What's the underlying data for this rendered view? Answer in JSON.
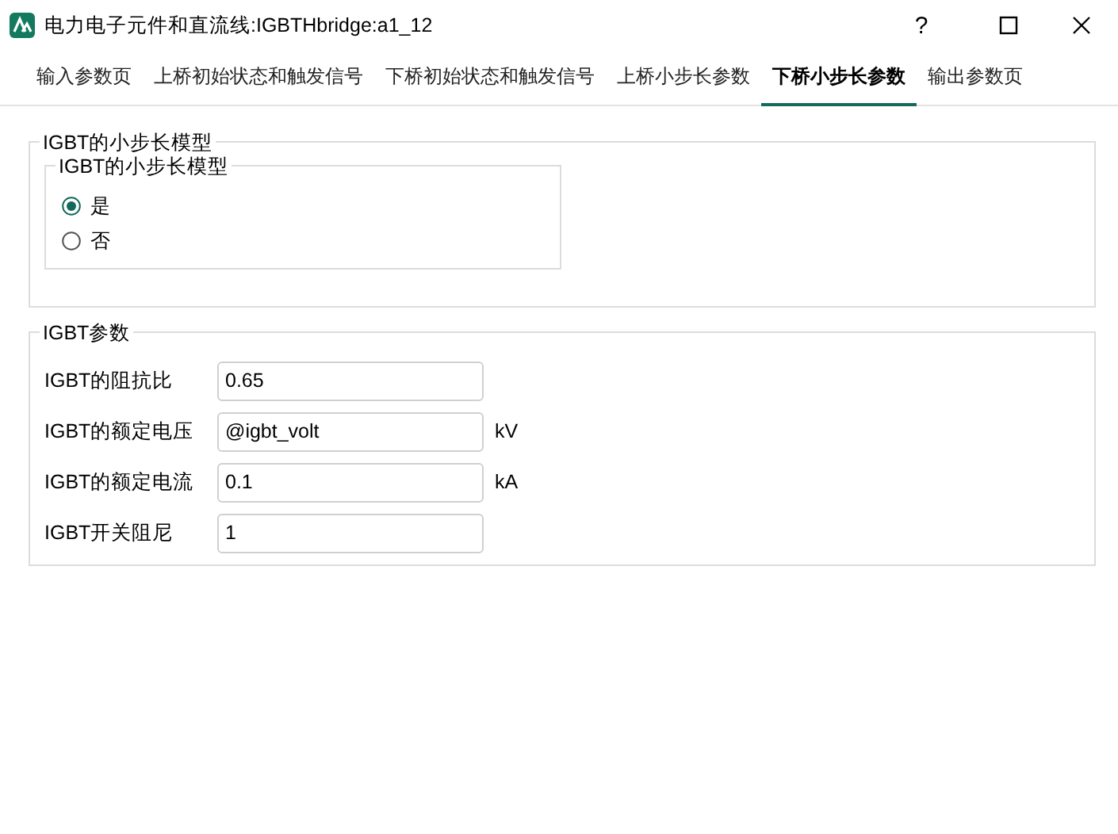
{
  "window": {
    "title": "电力电子元件和直流线:IGBTHbridge:a1_12",
    "help": "?"
  },
  "tabs": [
    {
      "label": "输入参数页",
      "selected": false
    },
    {
      "label": "上桥初始状态和触发信号",
      "selected": false
    },
    {
      "label": "下桥初始状态和触发信号",
      "selected": false
    },
    {
      "label": "上桥小步长参数",
      "selected": false
    },
    {
      "label": "下桥小步长参数",
      "selected": true
    },
    {
      "label": "输出参数页",
      "selected": false
    }
  ],
  "model_group": {
    "title": "IGBT的小步长模型",
    "inner_title": "IGBT的小步长模型",
    "options": [
      {
        "label": "是",
        "selected": true
      },
      {
        "label": "否",
        "selected": false
      }
    ]
  },
  "params_group": {
    "title": "IGBT参数",
    "rows": [
      {
        "label": "IGBT的阻抗比",
        "value": "0.65"
      },
      {
        "label": "IGBT的额定电压",
        "value": "@igbt_volt",
        "unit": "kV"
      },
      {
        "label": "IGBT的额定电流",
        "value": "0.1",
        "unit": "kA"
      },
      {
        "label": "IGBT开关阻尼",
        "value": "1"
      }
    ]
  }
}
